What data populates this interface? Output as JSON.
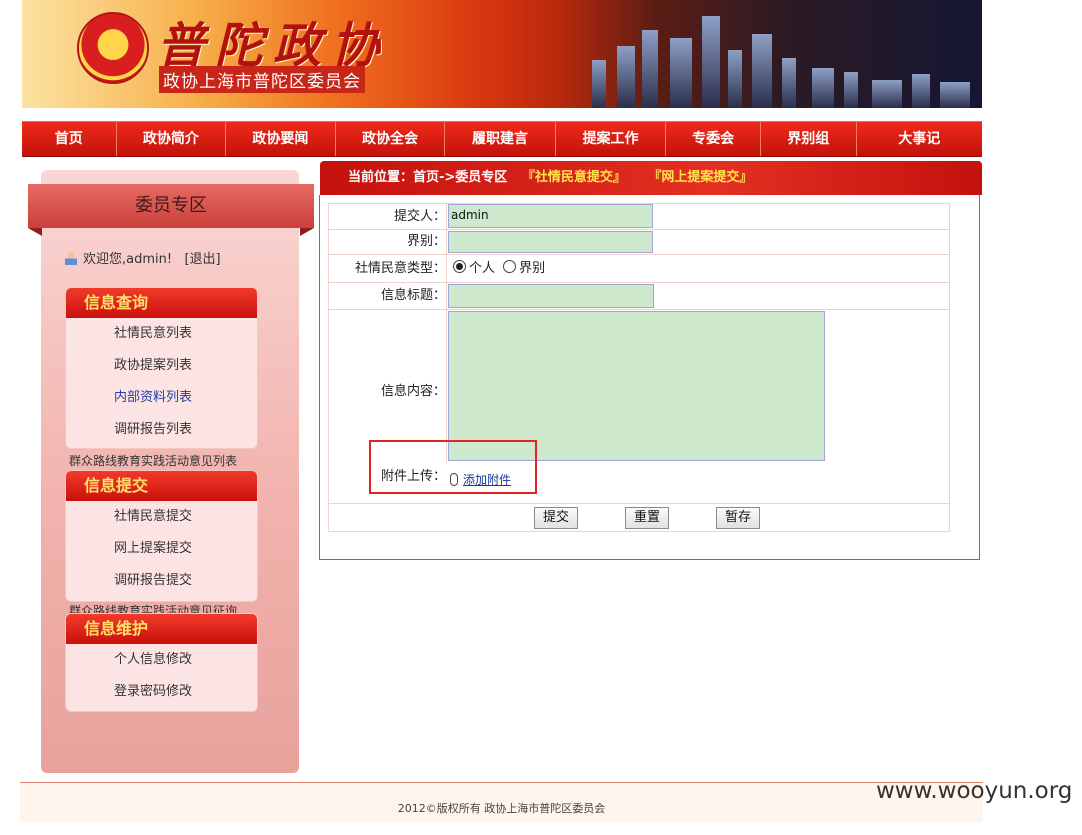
{
  "header": {
    "title": "普陀政协",
    "subtitle": "政协上海市普陀区委员会"
  },
  "nav": [
    {
      "label": "首页"
    },
    {
      "label": "政协简介"
    },
    {
      "label": "政协要闻"
    },
    {
      "label": "政协全会"
    },
    {
      "label": "履职建言"
    },
    {
      "label": "提案工作"
    },
    {
      "label": "专委会"
    },
    {
      "label": "界别组"
    },
    {
      "label": "大事记"
    }
  ],
  "sidebar": {
    "title": "委员专区",
    "welcome": "欢迎您,admin!",
    "logout": "[退出]",
    "query": {
      "head": "信息查询",
      "items": [
        "社情民意列表",
        "政协提案列表",
        "内部资料列表",
        "调研报告列表"
      ],
      "note": "群众路线教育实践活动意见列表"
    },
    "submit": {
      "head": "信息提交",
      "items": [
        "社情民意提交",
        "网上提案提交",
        "调研报告提交"
      ],
      "note": "群众路线教育实践活动意见征询"
    },
    "maintain": {
      "head": "信息维护",
      "items": [
        "个人信息修改",
        "登录密码修改"
      ]
    }
  },
  "breadcrumb": {
    "text": "当前位置：首页->委员专区",
    "link1": "『社情民意提交』",
    "link2": "『网上提案提交』"
  },
  "form": {
    "submitter_label": "提交人：",
    "submitter_value": "admin",
    "sector_label": "界别：",
    "type_label": "社情民意类型：",
    "type_option1": "个人",
    "type_option2": "界别",
    "info_title_label": "信息标题：",
    "content_label": "信息内容：",
    "attach_label": "附件上传：",
    "attach_link": "添加附件",
    "buttons": {
      "submit": "提交",
      "reset": "重置",
      "save": "暂存"
    }
  },
  "footer": {
    "text": "2012©版权所有  政协上海市普陀区委员会"
  },
  "watermark": "www.wooyun.org"
}
